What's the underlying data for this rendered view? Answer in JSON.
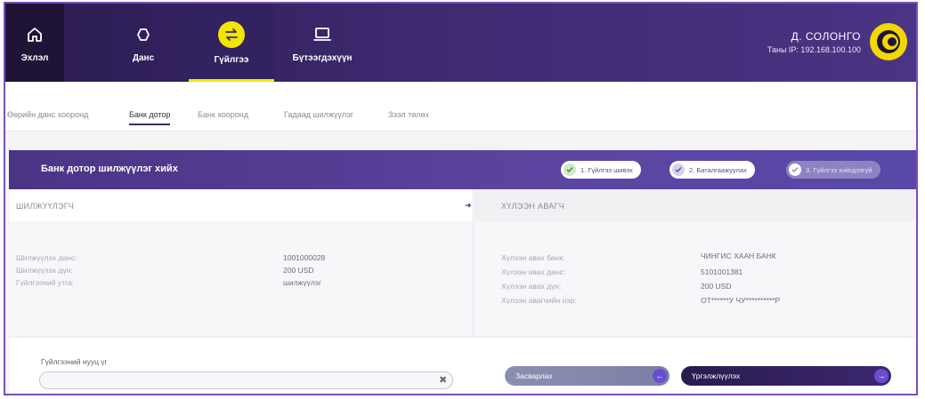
{
  "nav": {
    "items": [
      {
        "label": "Эхлэл",
        "icon": "home-icon"
      },
      {
        "label": "Данс",
        "icon": "account-icon"
      },
      {
        "label": "Гүйлгээ",
        "icon": "transfer-icon"
      },
      {
        "label": "Бүтээгдэхүүн",
        "icon": "laptop-icon"
      }
    ],
    "active_index": 2,
    "active_color": "#f2e600"
  },
  "user": {
    "name": "Д. СОЛОНГО",
    "ip": "Таны IP: 192.168.100.100"
  },
  "subtabs": [
    "Өөрийн данс хооронд",
    "Банк дотор",
    "Банк хооронд",
    "Гадаад шилжүүлэг",
    "Зээл төлөх"
  ],
  "subtab_active_index": 1,
  "section": {
    "title": "Банк дотор шилжүүлэг хийх",
    "steps": [
      "1. Гүйлгээ шивэх",
      "2. Баталгаажуулах",
      "3. Гүйлгээ хийгдээгүй"
    ]
  },
  "sender": {
    "header": "ШИЛЖҮҮЛЭГЧ",
    "rows": [
      {
        "label": "Шилжүүлэх данс:",
        "value": "1001000028"
      },
      {
        "label": "Шилжүүлэх дүн:",
        "value": "200 USD"
      },
      {
        "label": "Гүйлгээний утга:",
        "value": "шилжүүлэг"
      }
    ]
  },
  "receiver": {
    "header": "ХҮЛЭЭН АВАГЧ",
    "rows": [
      {
        "label": "Хүлээн авах банк:",
        "value": "ЧИНГИС ХААН БАНК"
      },
      {
        "label": "Хүлээн авах данс:",
        "value": "5101001381"
      },
      {
        "label": "Хүлээн авах дүн:",
        "value": "200 USD"
      },
      {
        "label": "Хүлээн авагчийн нэр:",
        "value": "ОТ******У ЧУ**********Р"
      }
    ]
  },
  "password": {
    "label": "Гүйлгээний нууц үг",
    "value": "",
    "placeholder": ""
  },
  "buttons": {
    "edit": "Засварлах",
    "continue": "Үргэлжлүүлэх"
  },
  "colors": {
    "nav_bg": "#2a1b4f",
    "band_bg": "#4a3484",
    "accent": "#6a4dd0"
  }
}
